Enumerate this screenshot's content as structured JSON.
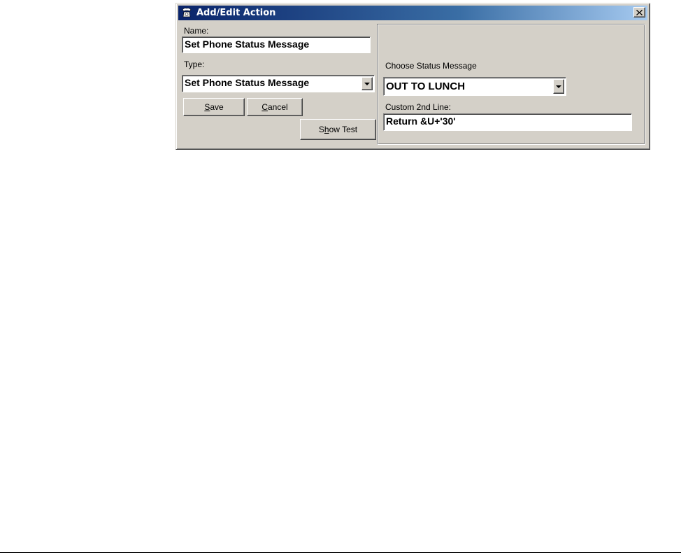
{
  "window": {
    "title": "Add/Edit Action",
    "close_glyph": "×"
  },
  "left": {
    "name_label": "Name:",
    "name_value": "Set Phone Status Message",
    "type_label": "Type:",
    "type_value": "Set Phone Status Message",
    "save_key": "S",
    "save_rest": "ave",
    "cancel_key": "C",
    "cancel_rest": "ancel",
    "show_test_pre": "S",
    "show_test_key": "h",
    "show_test_rest": "ow Test"
  },
  "right": {
    "status_label": "Choose Status Message",
    "status_value": "OUT TO LUNCH",
    "custom_label": "Custom 2nd Line:",
    "custom_value": "Return &U+'30'"
  },
  "icons": {
    "title_icon": "phone-icon",
    "close_icon": "close-icon",
    "dropdown_icon": "chevron-down-icon"
  },
  "colors": {
    "titlebar_start": "#0a246a",
    "titlebar_end": "#a6caf0",
    "face": "#d4d0c8"
  }
}
